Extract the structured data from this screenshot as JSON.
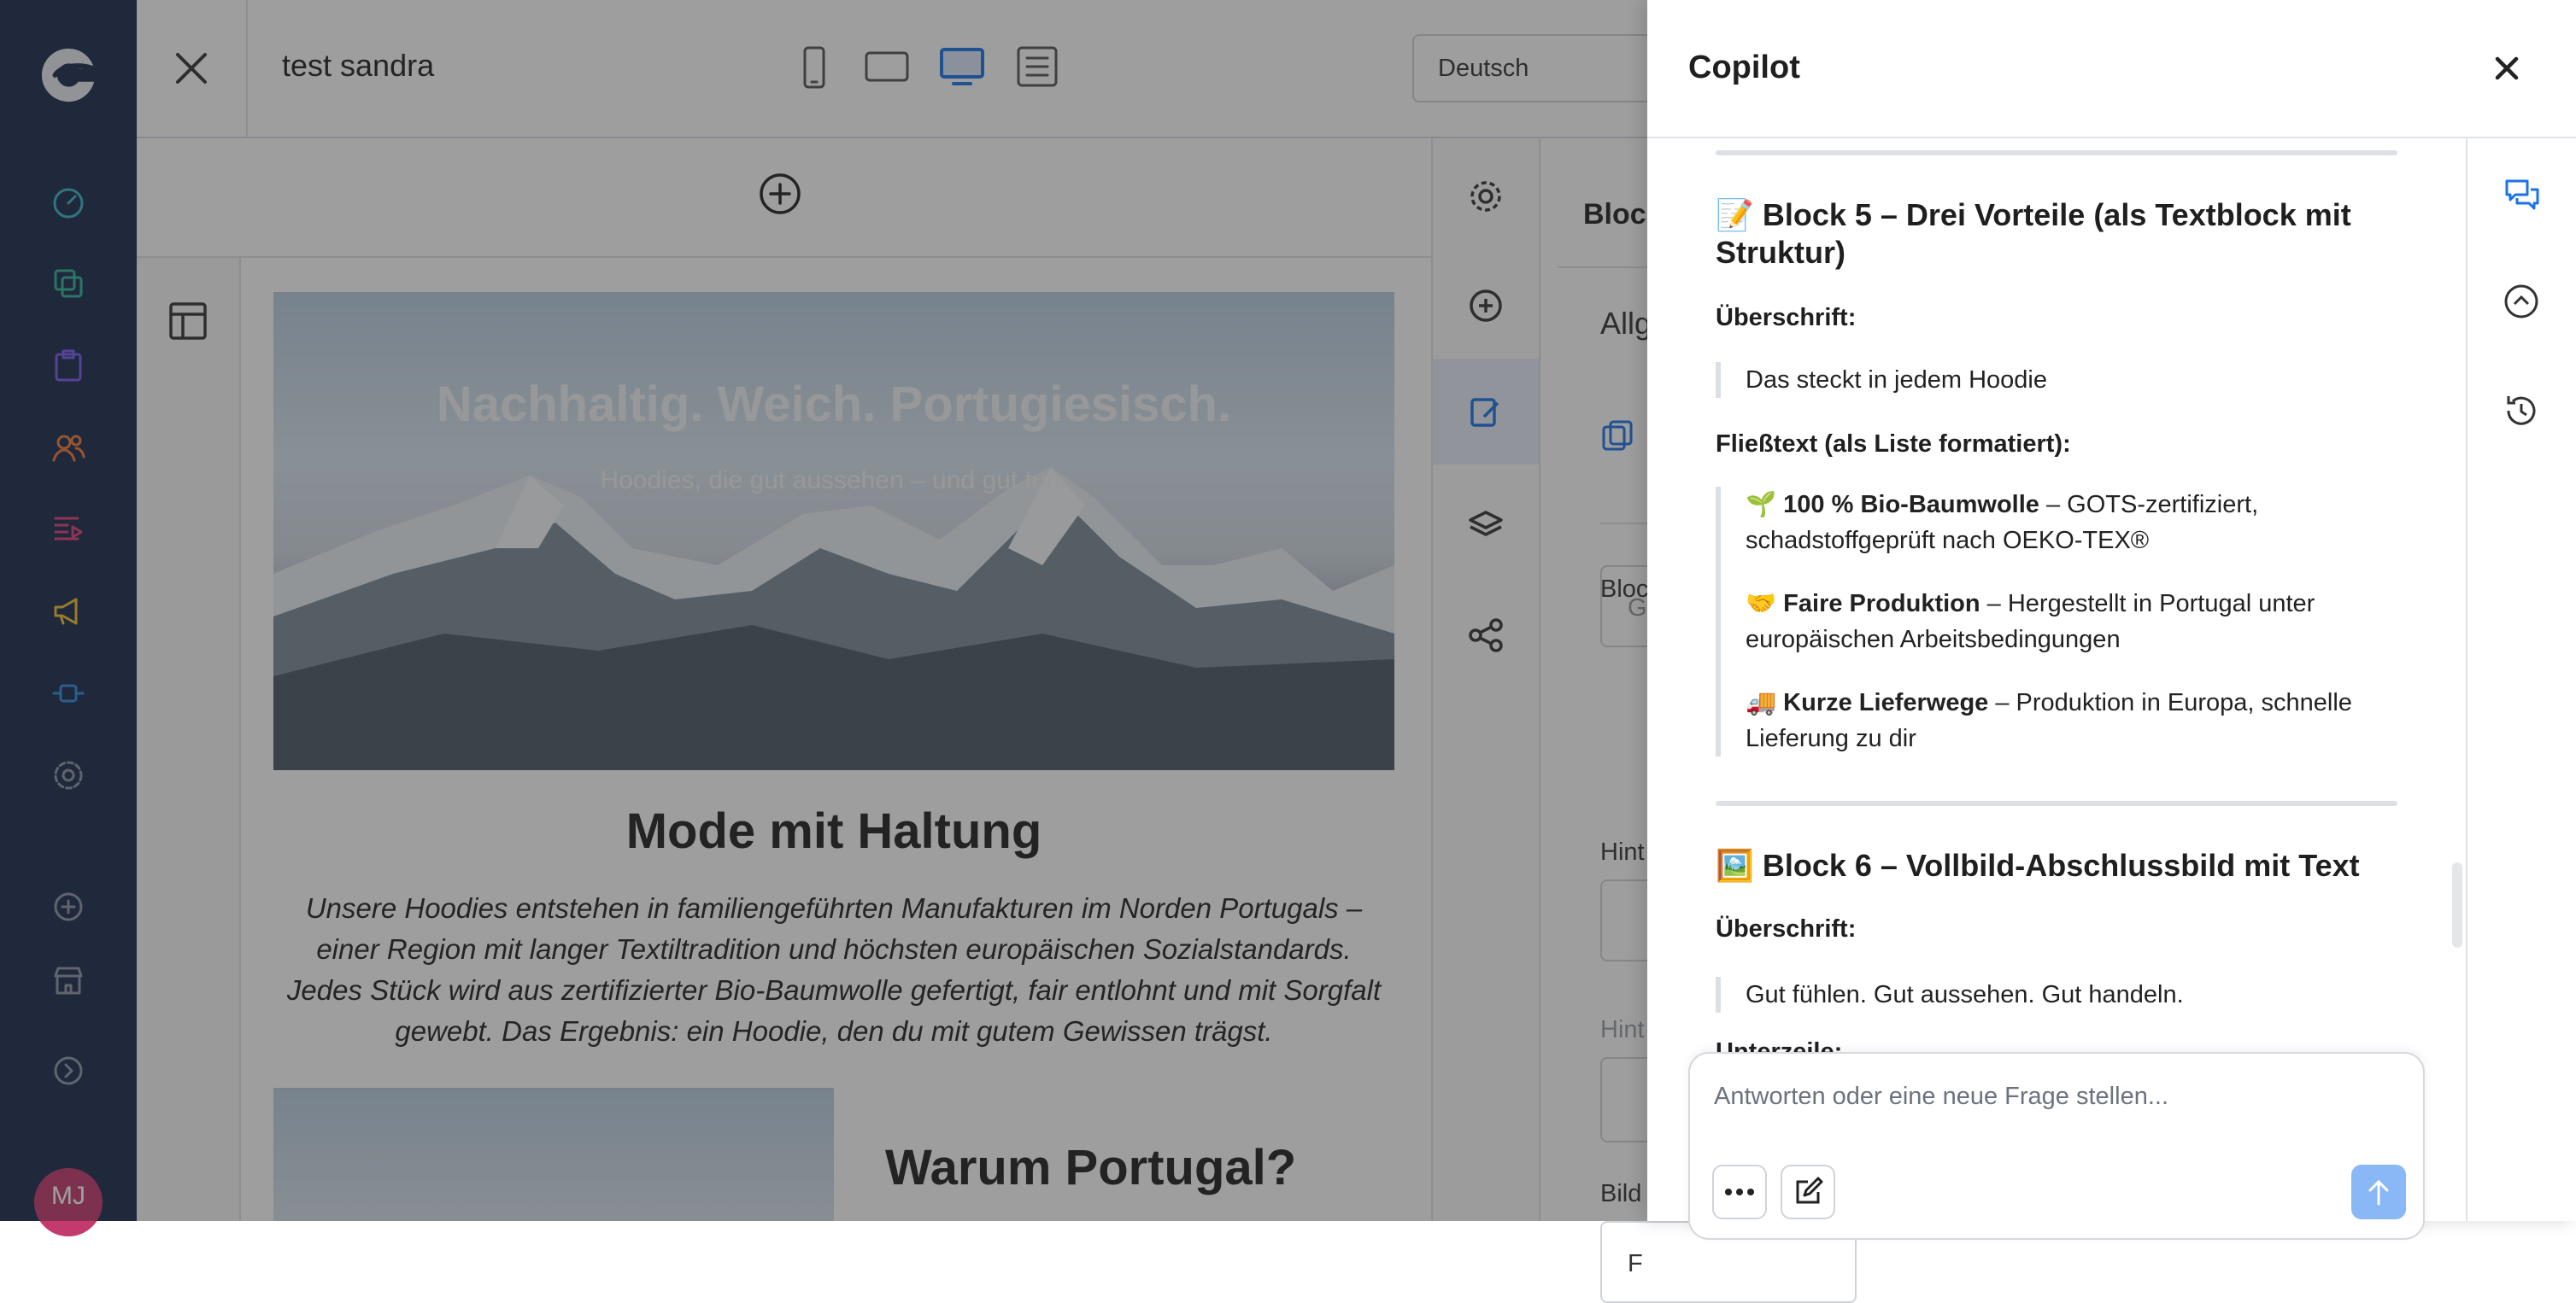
{
  "app": {
    "avatar_initials": "MJ"
  },
  "header": {
    "title": "test sandra",
    "language": "Deutsch"
  },
  "hero": {
    "title": "Nachhaltig. Weich. Portugiesisch.",
    "subtitle": "Hoodies, die gut aussehen – und gut tun."
  },
  "content": {
    "section_title": "Mode mit Haltung",
    "paragraph": "Unsere Hoodies entstehen in familiengeführten Manufakturen im Norden Portugals – einer Region mit langer Textiltradition und höchsten europäischen Sozialstandards. Jedes Stück wird aus zertifizierter Bio-Baumwolle gefertigt, fair entlohnt und mit Sorgfalt gewebt. Das Ergebnis: ein Hoodie, den du mit gutem Gewissen trägst.",
    "second_title": "Warum Portugal?"
  },
  "props": {
    "tab": "Block",
    "section": "Allg",
    "label1": "Block",
    "field1": "G",
    "label2": "Hint",
    "label3": "Hint",
    "label4": "Bild",
    "field4": "F"
  },
  "copilot": {
    "title": "Copilot",
    "block5_heading": "📝 Block 5 – Drei Vorteile (als Textblock mit Struktur)",
    "heading_label": "Überschrift:",
    "block5_quote": "Das steckt in jedem Hoodie",
    "body_label": "Fließtext (als Liste formatiert):",
    "items": [
      {
        "emoji": "🌱",
        "bold": "100 % Bio-Baumwolle",
        "rest": " – GOTS-zertifiziert, schadstoffgeprüft nach OEKO-TEX®"
      },
      {
        "emoji": "🤝",
        "bold": "Faire Produktion",
        "rest": " – Hergestellt in Portugal unter europäischen Arbeitsbedingungen"
      },
      {
        "emoji": "🚚",
        "bold": "Kurze Lieferwege",
        "rest": " – Produktion in Europa, schnelle Lieferung zu dir"
      }
    ],
    "block6_heading": "🖼️ Block 6 – Vollbild-Abschlussbild mit Text",
    "block6_label": "Überschrift:",
    "block6_quote": "Gut fühlen. Gut aussehen. Gut handeln.",
    "cut_label": "Unterzeile:",
    "input_placeholder": "Antworten oder eine neue Frage stellen..."
  },
  "colors": {
    "nav_bg": "#1a2b4c",
    "accent": "#1a73e8",
    "avatar": "#c43a6e"
  }
}
